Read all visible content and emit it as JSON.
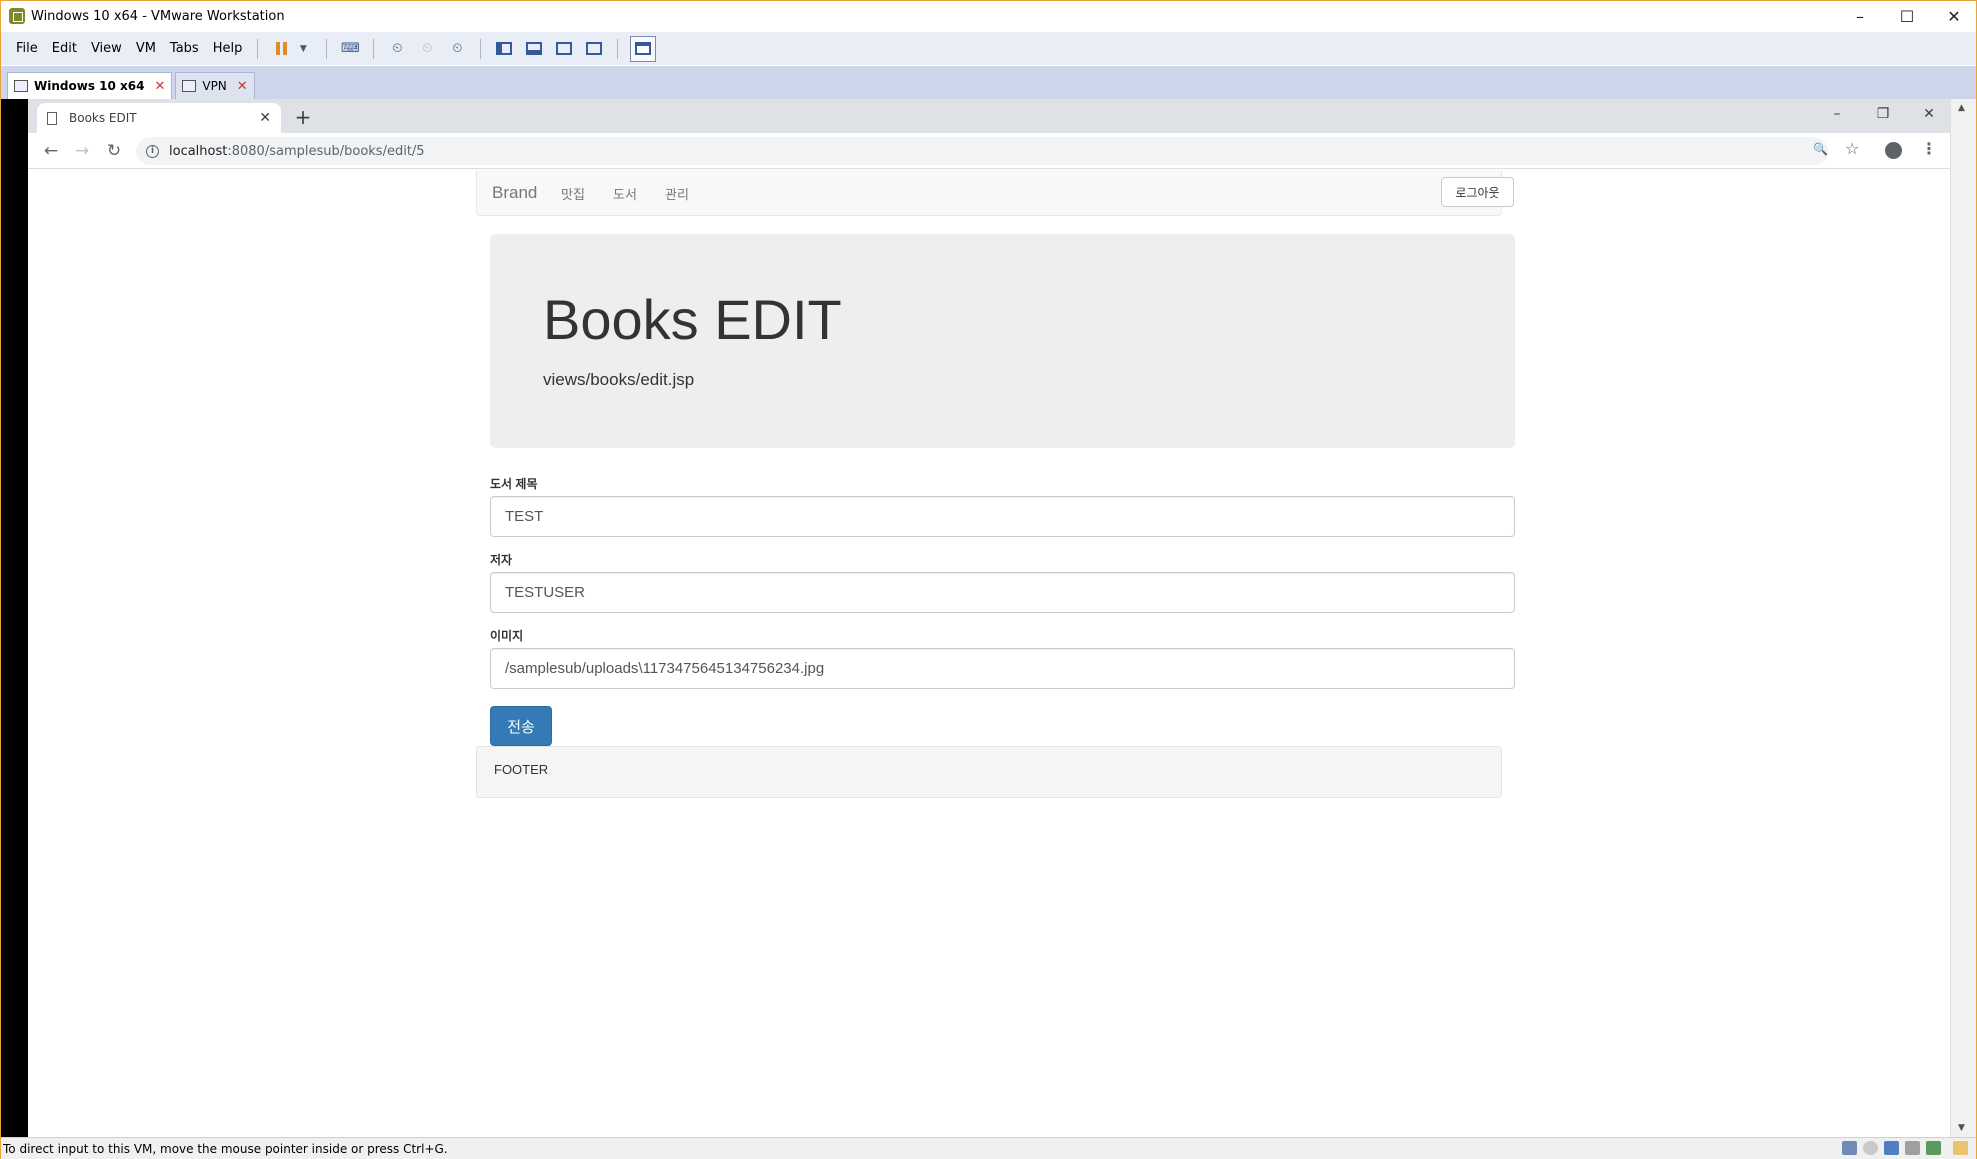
{
  "vmware": {
    "title": "Windows 10 x64 - VMware Workstation",
    "window_controls": [
      "–",
      "☐",
      "✕"
    ],
    "menu": [
      "File",
      "Edit",
      "View",
      "VM",
      "Tabs",
      "Help"
    ],
    "tabs": [
      {
        "label": "Windows 10 x64",
        "active": true
      },
      {
        "label": "VPN",
        "active": false
      }
    ],
    "tab_close": "✕",
    "status_text": "To direct input to this VM, move the mouse pointer inside or press Ctrl+G."
  },
  "browser": {
    "tab_title": "Books EDIT",
    "tab_close": "✕",
    "new_tab": "+",
    "window_controls": [
      "–",
      "❐",
      "✕"
    ],
    "url_host": "localhost",
    "url_rest": ":8080/samplesub/books/edit/5",
    "nav": {
      "back": "←",
      "forward": "→",
      "reload": "↻"
    },
    "icons": {
      "zoom": "🔍",
      "star": "☆",
      "menu": "⋮"
    }
  },
  "page": {
    "navbar": {
      "brand": "Brand",
      "links": [
        "맛집",
        "도서",
        "관리"
      ],
      "logout": "로그아웃"
    },
    "jumbotron": {
      "title": "Books EDIT",
      "subtitle": "views/books/edit.jsp"
    },
    "form": {
      "title_label": "도서 제목",
      "title_value": "TEST",
      "author_label": "저자",
      "author_value": "TESTUSER",
      "image_label": "이미지",
      "image_value": "/samplesub/uploads\\1173475645134756234.jpg",
      "submit": "전송"
    },
    "footer": "FOOTER"
  },
  "colors": {
    "vm_border": "#e8a33c",
    "vm_menubar": "#e9edf6",
    "vm_tabbar": "#cdd6ea",
    "primary_button": "#337ab7",
    "jumbotron_bg": "#eeeeee",
    "navbar_bg": "#f8f8f8"
  }
}
